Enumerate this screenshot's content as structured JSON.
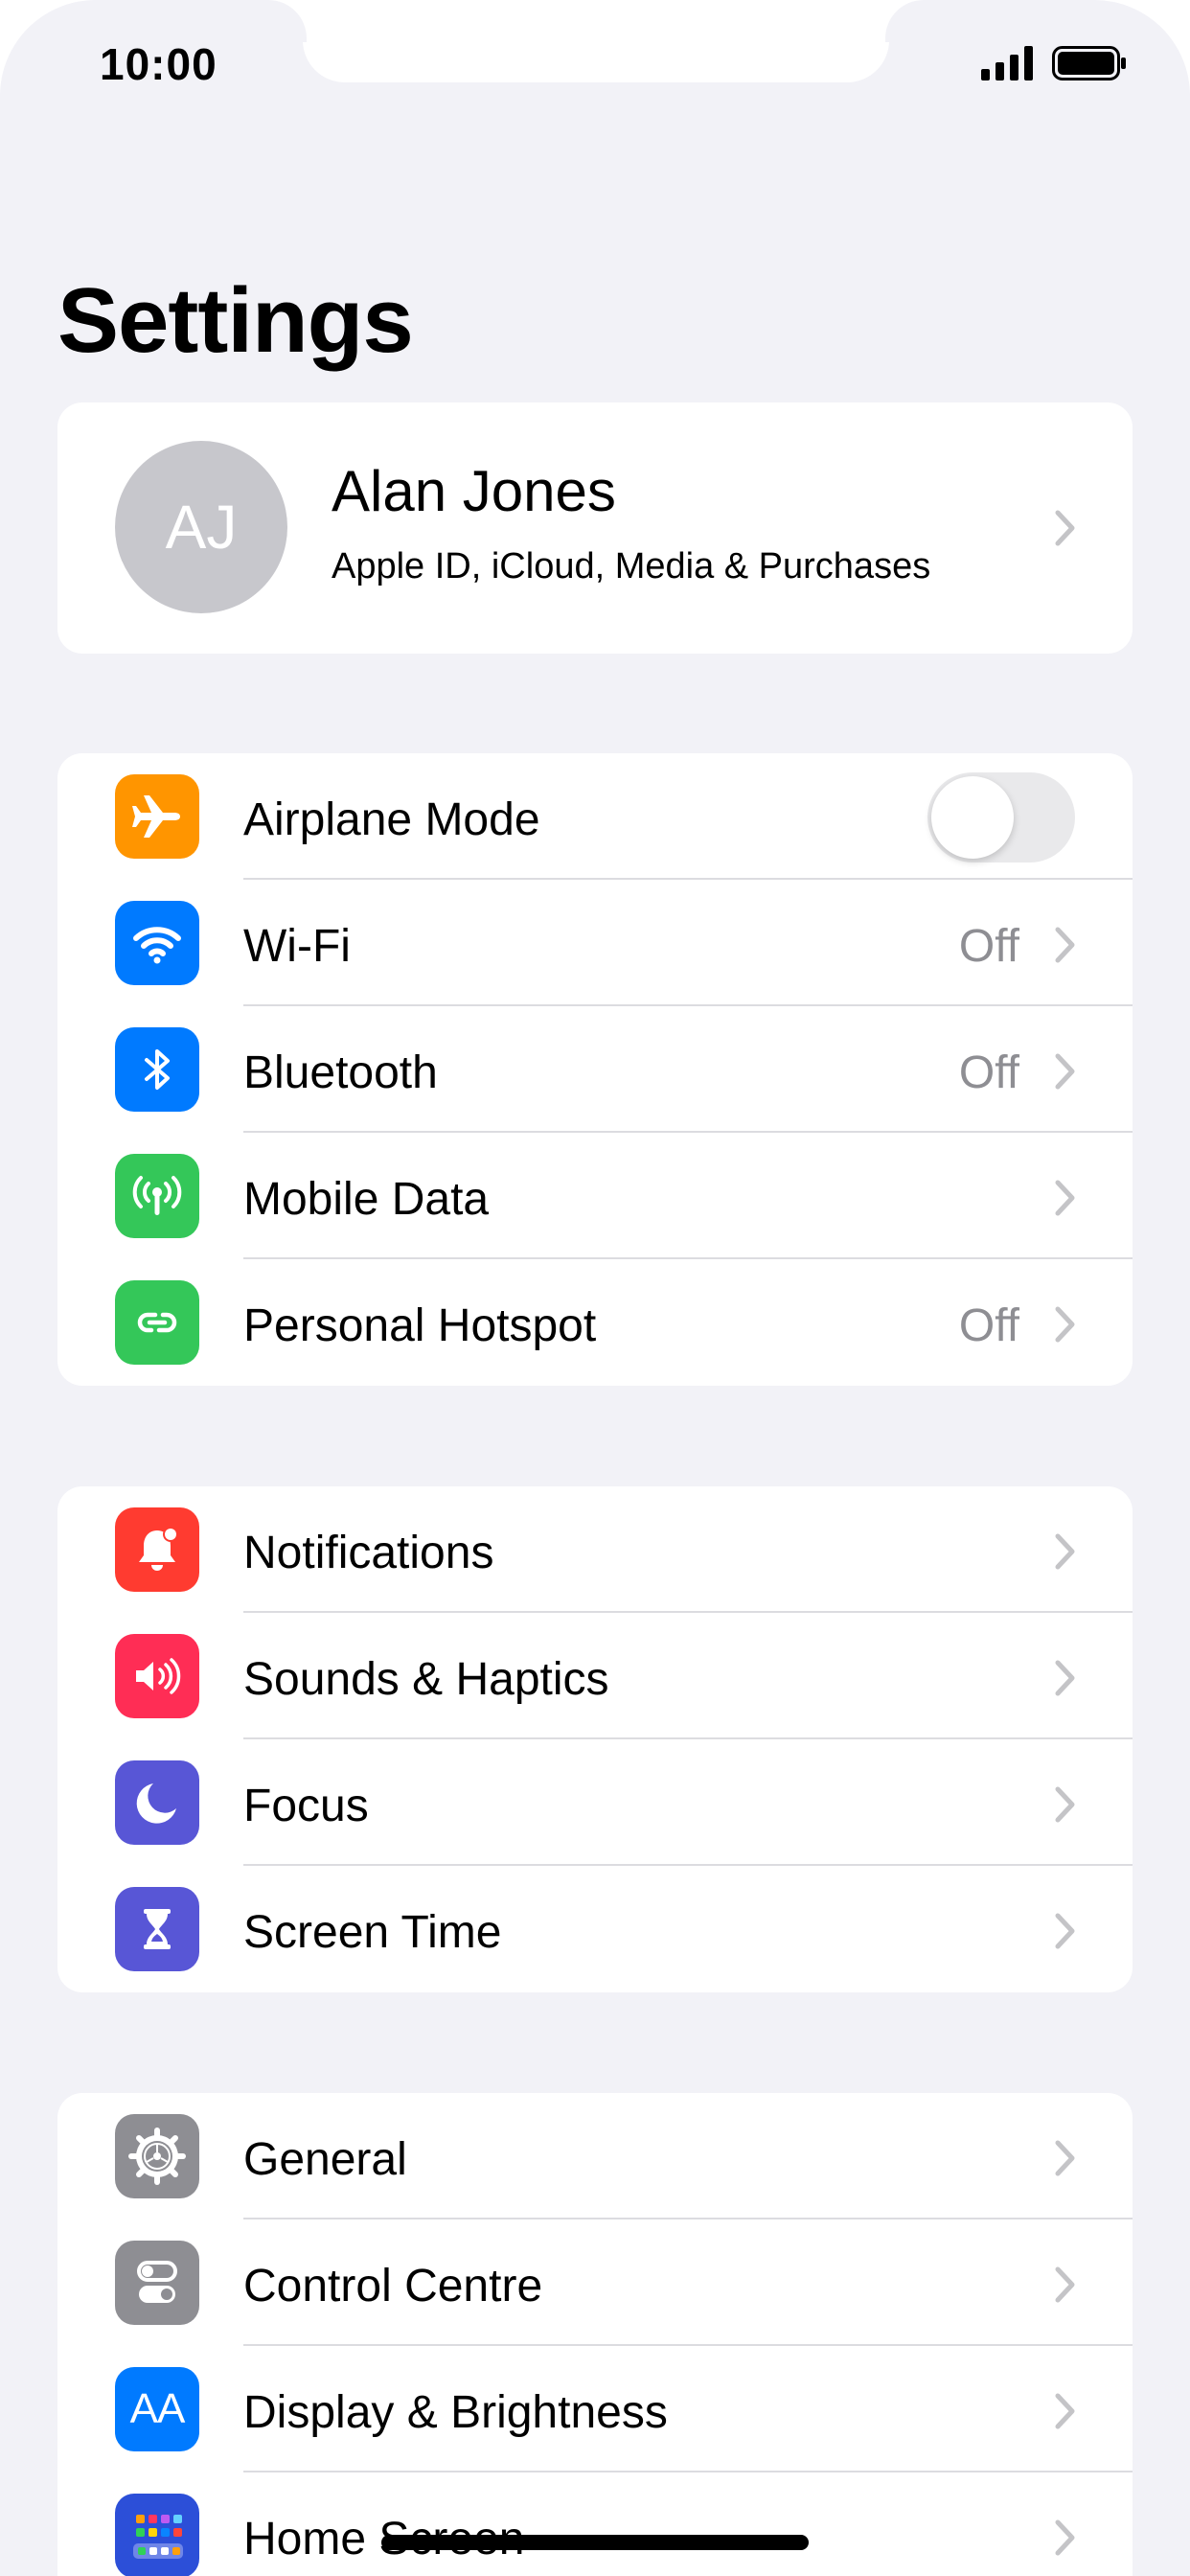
{
  "status_bar": {
    "time": "10:00"
  },
  "title": "Settings",
  "profile": {
    "initials": "AJ",
    "name": "Alan Jones",
    "subtitle": "Apple ID, iCloud, Media & Purchases"
  },
  "connectivity": [
    {
      "label": "Airplane Mode",
      "value": "",
      "icon": "airplane-icon",
      "color": "#ff9500",
      "toggle": false
    },
    {
      "label": "Wi-Fi",
      "value": "Off",
      "icon": "wifi-icon",
      "color": "#007aff"
    },
    {
      "label": "Bluetooth",
      "value": "Off",
      "icon": "bluetooth-icon",
      "color": "#007aff"
    },
    {
      "label": "Mobile Data",
      "value": "",
      "icon": "antenna-icon",
      "color": "#34c759"
    },
    {
      "label": "Personal Hotspot",
      "value": "Off",
      "icon": "hotspot-icon",
      "color": "#34c759"
    }
  ],
  "attention": [
    {
      "label": "Notifications",
      "icon": "bell-icon",
      "color": "#ff3b30"
    },
    {
      "label": "Sounds & Haptics",
      "icon": "speaker-icon",
      "color": "#ff2d55"
    },
    {
      "label": "Focus",
      "icon": "moon-icon",
      "color": "#5856d6"
    },
    {
      "label": "Screen Time",
      "icon": "hourglass-icon",
      "color": "#5856d6"
    }
  ],
  "system": [
    {
      "label": "General",
      "icon": "gear-icon",
      "color": "#8e8e93"
    },
    {
      "label": "Control Centre",
      "icon": "switches-icon",
      "color": "#8e8e93"
    },
    {
      "label": "Display & Brightness",
      "icon": "text-size-icon",
      "color": "#007aff",
      "glyph": "AA"
    },
    {
      "label": "Home Screen",
      "icon": "home-screen-icon",
      "color": "#2c4fd8"
    }
  ]
}
